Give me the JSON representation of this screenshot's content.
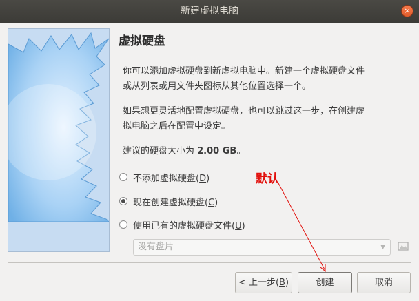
{
  "window": {
    "title": "新建虚拟电脑",
    "close_glyph": "×"
  },
  "heading": "虚拟硬盘",
  "paragraphs": [
    [
      "你可以添加虚拟硬盘到新虚拟电脑中。新建一个虚拟硬盘文件",
      "或从列表或用文件夹图标从其他位置选择一个。"
    ],
    [
      "如果想更灵活地配置虚拟硬盘，也可以跳过这一步，在创建虚",
      "拟电脑之后在配置中设定。"
    ]
  ],
  "recommendation": {
    "prefix": "建议的硬盘大小为 ",
    "size": "2.00 GB",
    "suffix": "。"
  },
  "options": [
    {
      "label": "不添加虚拟硬盘(",
      "mnemonic": "D",
      "close": ")",
      "checked": false
    },
    {
      "label": "现在创建虚拟硬盘(",
      "mnemonic": "C",
      "close": ")",
      "checked": true
    },
    {
      "label": "使用已有的虚拟硬盘文件(",
      "mnemonic": "U",
      "close": ")",
      "checked": false
    }
  ],
  "disk_combo": {
    "value": "没有盘片"
  },
  "annotation": {
    "text": "默认",
    "color": "#e2110d"
  },
  "buttons": {
    "back": {
      "label": "< 上一步(",
      "mnemonic": "B",
      "close": ")"
    },
    "create": "创建",
    "cancel": "取消"
  }
}
